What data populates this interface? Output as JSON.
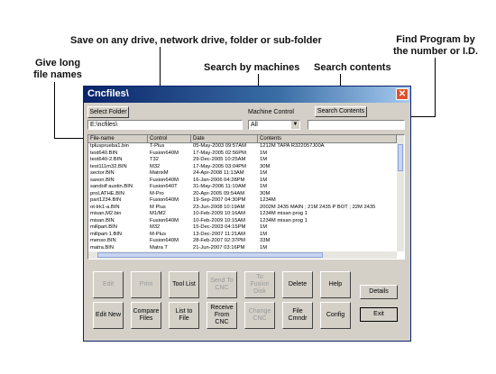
{
  "callouts": {
    "save": "Save on any drive, network drive, folder or sub-folder",
    "find": "Find Program by\nthe number or I.D.",
    "long_names": "Give long\nfile names",
    "search_machines": "Search by machines",
    "search_contents": "Search contents"
  },
  "window": {
    "title": "Cncfiles\\",
    "close_glyph": "✕",
    "select_folder": "Select Folder",
    "path": "E:\\ncfiles\\",
    "machine_control_label": "Machine Control",
    "machine_control_value": "All",
    "search_contents_button": "Search Contents",
    "search_value": ""
  },
  "table": {
    "headers": [
      "File-name",
      "Control",
      "Date",
      "Contents"
    ],
    "rows": [
      [
        "tplusprueba1.bin",
        "T-Plus",
        "05-May-2003 09:57AM",
        "1212M   TAPA R322057J00A"
      ],
      [
        "test640.BIN",
        "Fusion640M",
        "17-May-2005 02:56PM",
        "1M"
      ],
      [
        "test640-2.BIN",
        "T32",
        "29-Dec-2005 10:25AM",
        "1M"
      ],
      [
        "test111m32.BIN",
        "M32",
        "17-May-2005 03:04PM",
        "30M"
      ],
      [
        "sector.BIN",
        "MatrixM",
        "24-Apr-2008 11:13AM",
        "1M"
      ],
      [
        "saxon.BIN",
        "Fusion640M",
        "16-Jan-2006 04:28PM",
        "1M"
      ],
      [
        "sandolf austin.BIN",
        "Fusion640T",
        "31-May-2006 11:10AM",
        "1M"
      ],
      [
        "proLATHE.BIN",
        "M-Pro",
        "20-Apr-2005 09:54AM",
        "30M"
      ],
      [
        "part1234.BIN",
        "Fusion640M",
        "19-Sep-2007 04:30PM",
        "1234M"
      ],
      [
        "ot-lrk1-a.BIN",
        "M Plus",
        "23-Jun-2008 10:19AM",
        "2002M   2435 MAIN ; 21M   2435 P BOT ; 22M   2435"
      ],
      [
        "misan,M2.bin",
        "M1/M2",
        "10-Feb-2009 10:16AM",
        "1234M   misan prog 1"
      ],
      [
        "misan.BIN",
        "Fusion640M",
        "10-Feb-2009 10:15AM",
        "1234M   misan prog 1"
      ],
      [
        "millpart.BIN",
        "M32",
        "15-Dec-2003 04:15PM",
        "1M"
      ],
      [
        "millpart-1.BIN",
        "M-Plus",
        "13-Dec-2007 11:21AM",
        "1M"
      ],
      [
        "menso.BIN",
        "Fusion640M",
        "28-Feb-2007 02:37PM",
        "33M"
      ],
      [
        "matra.BIN",
        "Matra T",
        "21-Jun-2007 03:16PM",
        "1M"
      ]
    ]
  },
  "buttons": {
    "edit": "Edit",
    "print": "Print",
    "tool_list": "Tool List",
    "send_to_cnc": "Send To\nCNC",
    "to_fusion_disk": "To\nFusion\nDisk",
    "delete": "Delete",
    "help": "Help",
    "details": "Details",
    "edit_new": "Edit New",
    "compare_files": "Compare\nFiles",
    "list_to_file": "List to\nFile",
    "receive_from_cnc": "Receive\nFrom\nCNC",
    "change_cnc": "Change\nCNC",
    "file_cmndr": "File\nCmndr",
    "config": "Config",
    "exit": "Exit"
  }
}
